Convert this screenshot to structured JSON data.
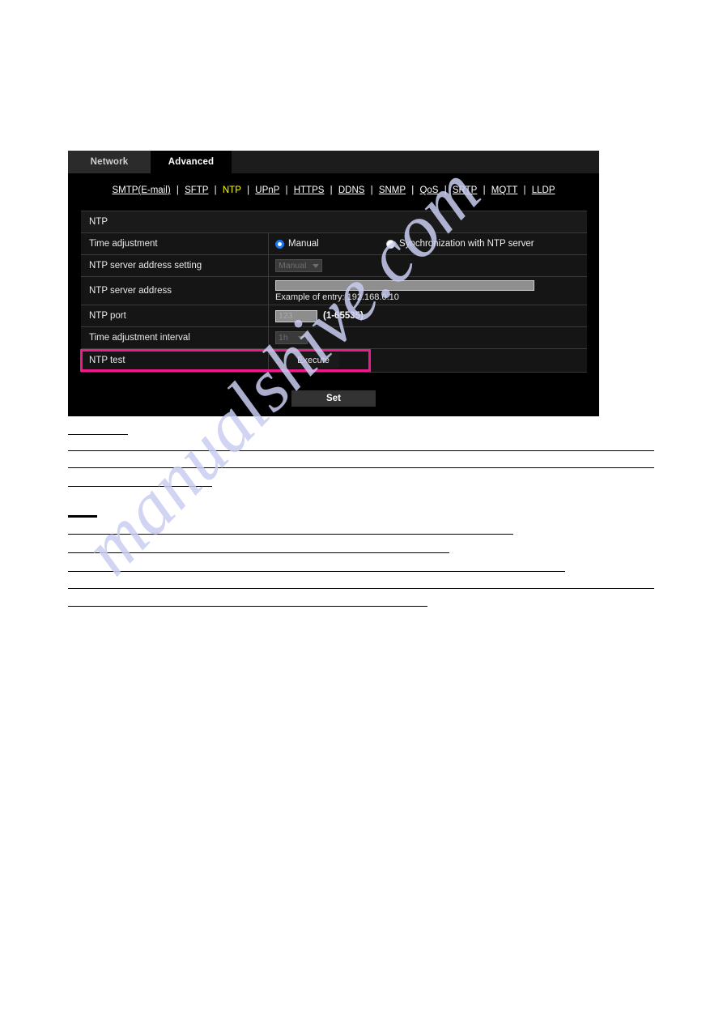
{
  "watermark": {
    "text": "manualshive.com"
  },
  "colors": {
    "highlight": "#ec1b8c",
    "current_link": "#ffff00",
    "radio_selected": "#1d77e8",
    "panel_bg": "#000000",
    "row_bg": "#151515"
  },
  "tabs": [
    {
      "label": "Network",
      "active": false
    },
    {
      "label": "Advanced",
      "active": true
    }
  ],
  "nav_links": [
    {
      "label": "SMTP(E-mail)",
      "current": false
    },
    {
      "label": "SFTP",
      "current": false
    },
    {
      "label": "NTP",
      "current": true
    },
    {
      "label": "UPnP",
      "current": false
    },
    {
      "label": "HTTPS",
      "current": false
    },
    {
      "label": "DDNS",
      "current": false
    },
    {
      "label": "SNMP",
      "current": false
    },
    {
      "label": "QoS",
      "current": false
    },
    {
      "label": "SRTP",
      "current": false
    },
    {
      "label": "MQTT",
      "current": false
    },
    {
      "label": "LLDP",
      "current": false
    }
  ],
  "nav_separator": "|",
  "section": {
    "title": "NTP"
  },
  "rows": {
    "time_adjustment": {
      "label": "Time adjustment",
      "option_manual": "Manual",
      "option_sync": "Synchronization with NTP server"
    },
    "server_address_setting": {
      "label": "NTP server address setting",
      "value": "Manual"
    },
    "server_address": {
      "label": "NTP server address",
      "value": "",
      "hint": "Example of entry: 192.168.0.10"
    },
    "port": {
      "label": "NTP port",
      "value": "123",
      "range": "(1-65535)"
    },
    "interval": {
      "label": "Time adjustment interval",
      "value": "1h"
    },
    "test": {
      "label": "NTP test",
      "button": "Execute"
    }
  },
  "footer": {
    "set_label": "Set"
  }
}
